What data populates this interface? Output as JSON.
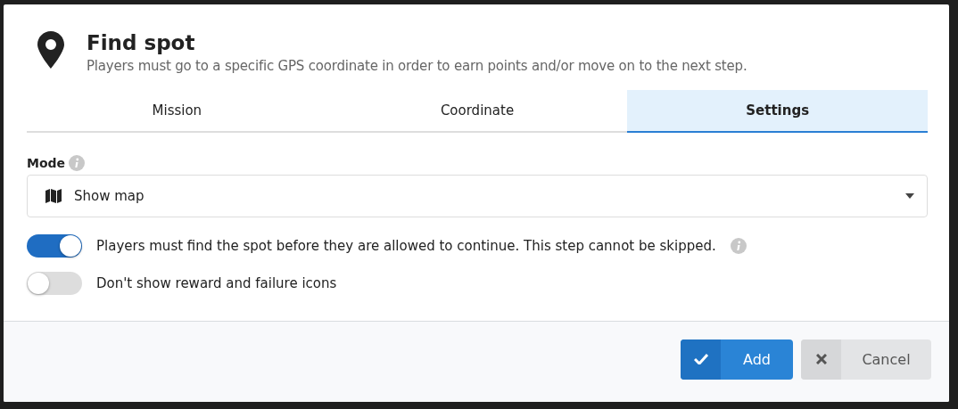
{
  "dialog": {
    "title": "Find spot",
    "subtitle": "Players must go to a specific GPS coordinate in order to earn points and/or move on to the next step."
  },
  "tabs": [
    {
      "label": "Mission",
      "selected": false
    },
    {
      "label": "Coordinate",
      "selected": false
    },
    {
      "label": "Settings",
      "selected": true
    }
  ],
  "mode": {
    "label": "Mode",
    "value": "Show map"
  },
  "toggles": [
    {
      "label": "Players must find the spot before they are allowed to continue. This step cannot be skipped.",
      "on": true,
      "info": true
    },
    {
      "label": "Don't show reward and failure icons",
      "on": false,
      "info": false
    }
  ],
  "buttons": [
    {
      "kind": "primary",
      "label": "Add"
    },
    {
      "kind": "secondary",
      "label": "Cancel"
    }
  ]
}
